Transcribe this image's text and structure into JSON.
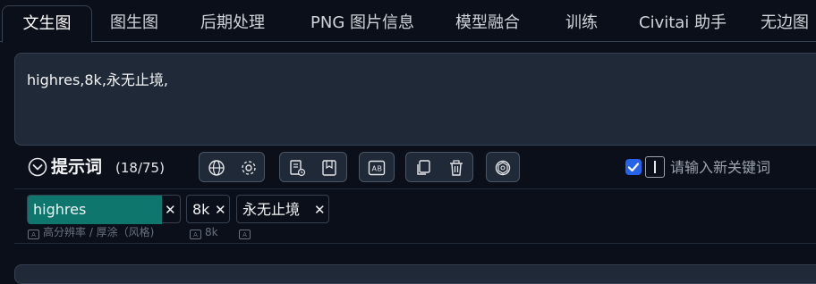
{
  "tabs": [
    {
      "label": "文生图",
      "active": true
    },
    {
      "label": "图生图"
    },
    {
      "label": "后期处理"
    },
    {
      "label": "PNG 图片信息"
    },
    {
      "label": "模型融合"
    },
    {
      "label": "训练"
    },
    {
      "label": "Civitai 助手"
    },
    {
      "label": "无边图"
    }
  ],
  "prompt": {
    "text": "highres,8k,永无止境,"
  },
  "prompt_panel": {
    "title": "提示词",
    "count": "(18/75)",
    "keyword_placeholder": "请输入新关键词",
    "keyword_checkbox_checked": true
  },
  "tags": [
    {
      "label": "highres",
      "sub": "高分辨率 / 厚涂（风格)",
      "highlight": "#0f766e"
    },
    {
      "label": "8k",
      "sub": "8k"
    },
    {
      "label": "永无止境",
      "sub": ""
    }
  ],
  "icons": {
    "toggle": "chevron-down-circle-icon",
    "group1": [
      "globe-icon",
      "gear-icon"
    ],
    "group2": [
      "history-icon",
      "bookmark-star-icon"
    ],
    "group3": [
      "translate-icon"
    ],
    "group4": [
      "copy-icon",
      "trash-icon"
    ],
    "group5": [
      "chatgpt-icon"
    ],
    "remove": "close-icon"
  },
  "colors": {
    "accent": "#2563eb",
    "tag_highlight": "#0f766e",
    "panel": "#1f2937",
    "background": "#0b0f19"
  }
}
